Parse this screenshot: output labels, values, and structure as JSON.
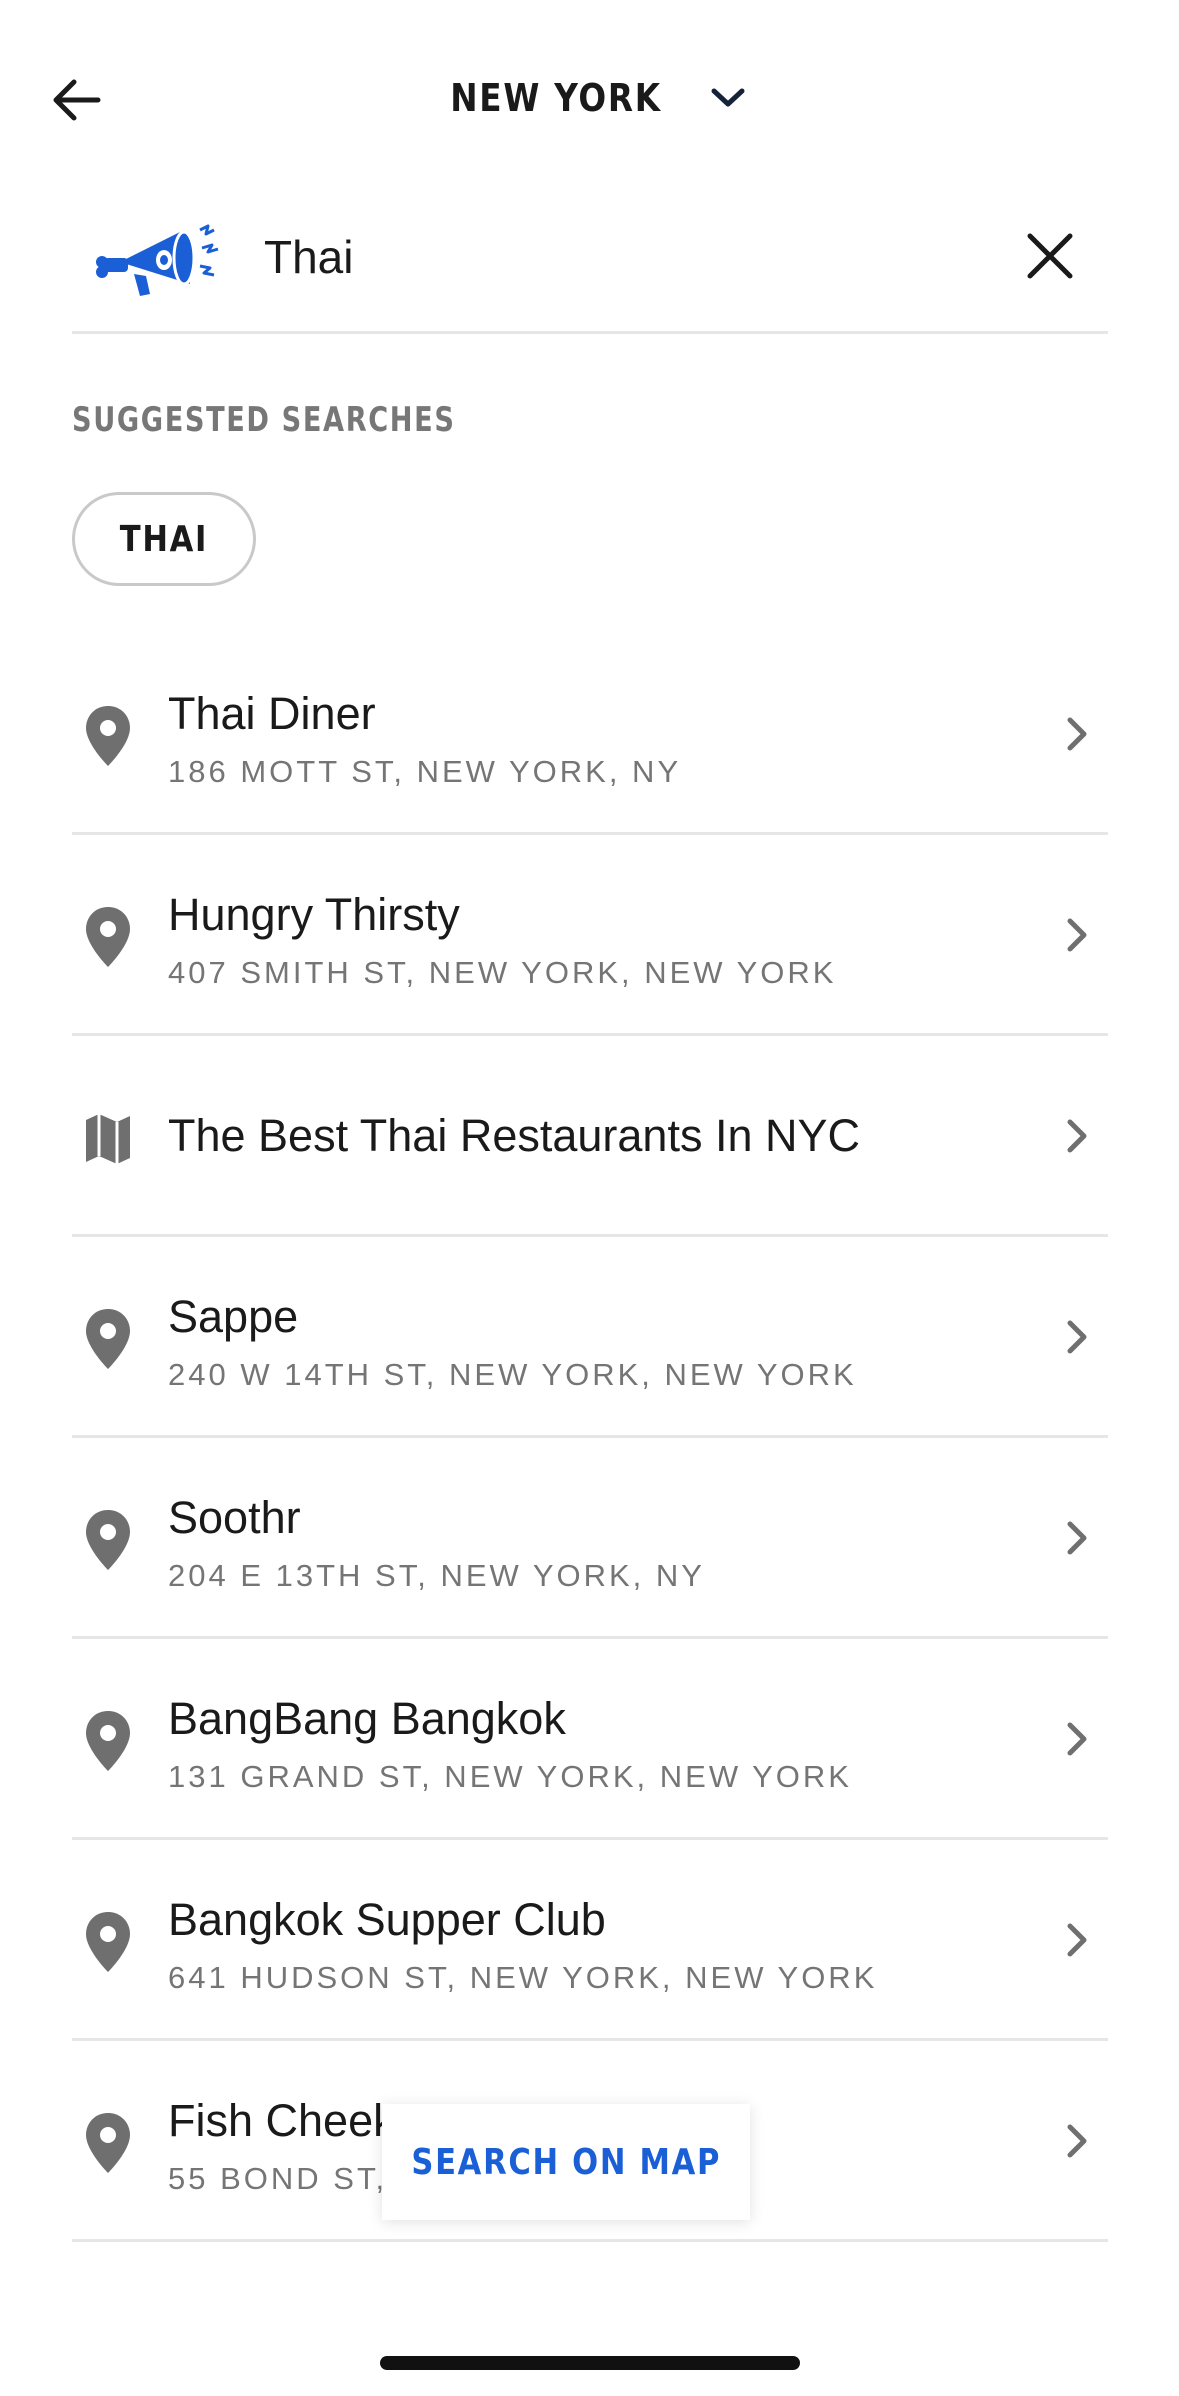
{
  "header": {
    "city": "NEW YORK"
  },
  "search": {
    "value": "Thai"
  },
  "suggested": {
    "title": "SUGGESTED SEARCHES",
    "chips": [
      "THAI"
    ]
  },
  "results": [
    {
      "title": "Thai Diner",
      "subtitle": "186 MOTT ST, NEW YORK, NY",
      "icon": "map-pin-icon"
    },
    {
      "title": "Hungry Thirsty",
      "subtitle": "407 SMITH ST, NEW YORK, NEW YORK",
      "icon": "map-pin-icon"
    },
    {
      "title": "The Best Thai Restaurants In NYC",
      "subtitle": "",
      "icon": "map-guide-icon"
    },
    {
      "title": "Sappe",
      "subtitle": "240 W 14TH ST, NEW YORK, NEW YORK",
      "icon": "map-pin-icon"
    },
    {
      "title": "Soothr",
      "subtitle": "204 E 13TH ST, NEW YORK, NY",
      "icon": "map-pin-icon"
    },
    {
      "title": "BangBang Bangkok",
      "subtitle": "131 GRAND ST, NEW YORK, NEW YORK",
      "icon": "map-pin-icon"
    },
    {
      "title": "Bangkok Supper Club",
      "subtitle": "641 HUDSON ST, NEW YORK, NEW YORK",
      "icon": "map-pin-icon"
    },
    {
      "title": "Fish Cheek",
      "subtitle": "55 BOND ST,",
      "icon": "map-pin-icon"
    }
  ],
  "map_button": {
    "label": "SEARCH ON MAP"
  },
  "colors": {
    "accent": "#1a5fd6",
    "text": "#1a1a1a",
    "muted": "#757575",
    "divider": "#e6e6e6",
    "icon_gray": "#6f6f6f"
  }
}
